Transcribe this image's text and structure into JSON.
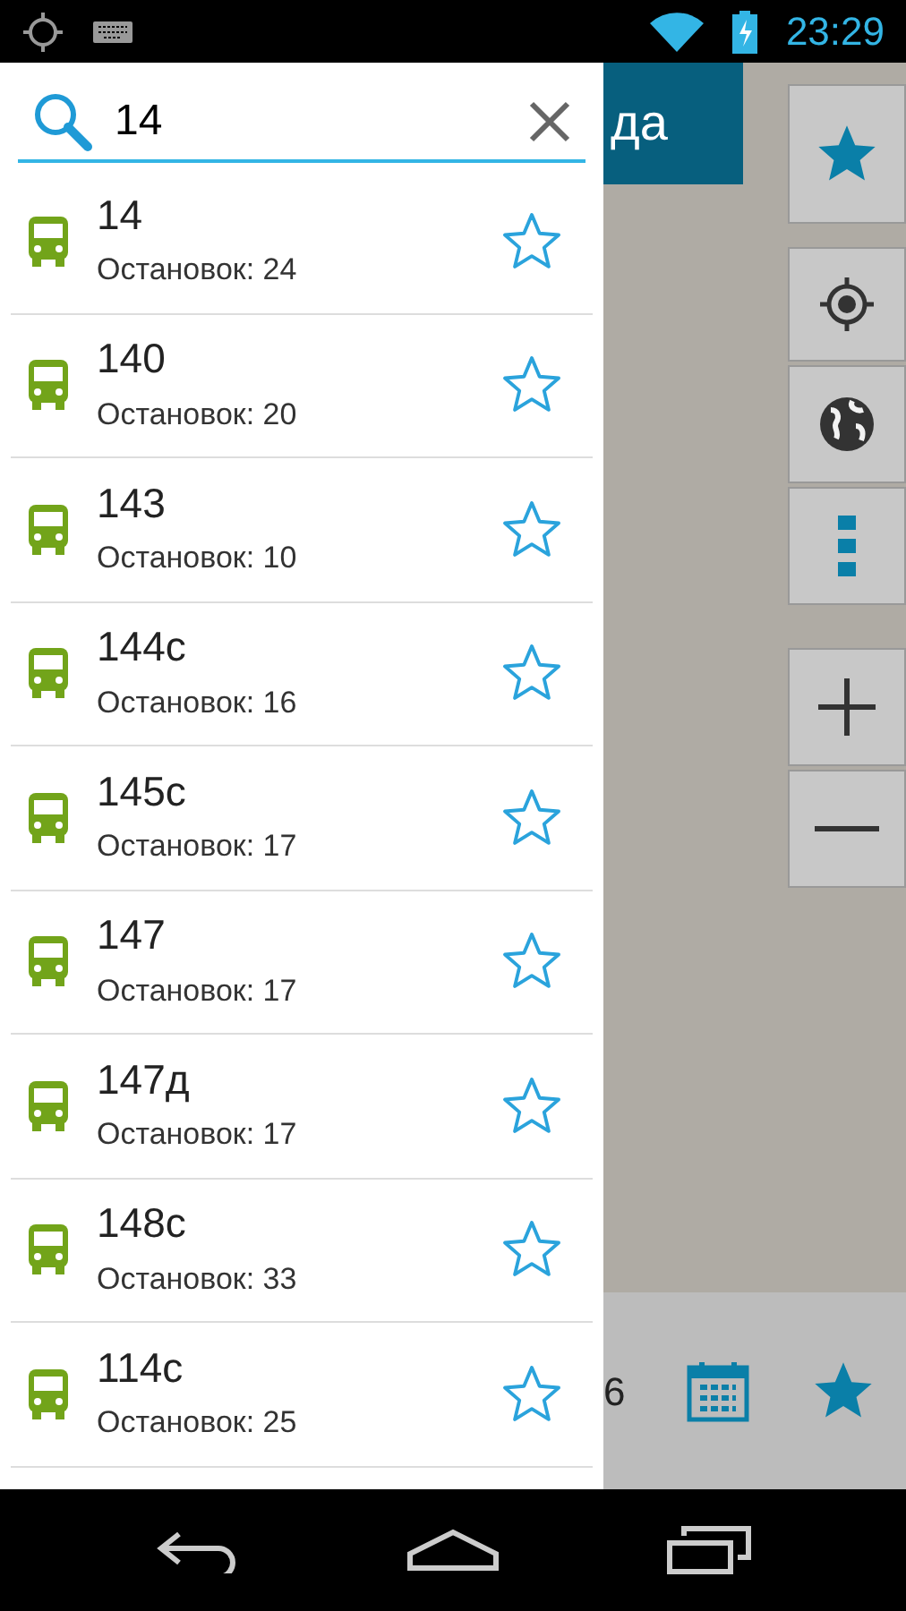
{
  "status_bar": {
    "time": "23:29"
  },
  "search": {
    "value": "14"
  },
  "routes": [
    {
      "number": "14",
      "stops": "Остановок: 24",
      "favorite": false
    },
    {
      "number": "140",
      "stops": "Остановок: 20",
      "favorite": false
    },
    {
      "number": "143",
      "stops": "Остановок: 10",
      "favorite": false
    },
    {
      "number": "144с",
      "stops": "Остановок: 16",
      "favorite": false
    },
    {
      "number": "145с",
      "stops": "Остановок: 17",
      "favorite": false
    },
    {
      "number": "147",
      "stops": "Остановок: 17",
      "favorite": false
    },
    {
      "number": "147д",
      "stops": "Остановок: 17",
      "favorite": false
    },
    {
      "number": "148с",
      "stops": "Остановок: 33",
      "favorite": false
    },
    {
      "number": "114с",
      "stops": "Остановок: 25",
      "favorite": false
    }
  ],
  "map": {
    "header_title": "да",
    "bottom_text": "6"
  }
}
